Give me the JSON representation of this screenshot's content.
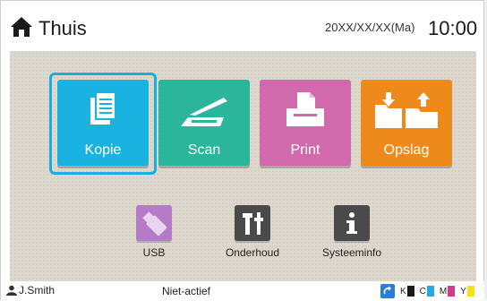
{
  "header": {
    "title": "Thuis",
    "date": "20XX/XX/XX(Ma)",
    "time": "10:00"
  },
  "tiles": [
    {
      "label": "Kopie",
      "color": "#1ab2e0",
      "icon": "copy-document-icon",
      "selected": true
    },
    {
      "label": "Scan",
      "color": "#2bb59a",
      "icon": "scanner-icon"
    },
    {
      "label": "Print",
      "color": "#d16aac",
      "icon": "printer-icon"
    },
    {
      "label": "Opslag",
      "color": "#ee8a1c",
      "icon": "folder-storage-icon"
    }
  ],
  "small_apps": [
    {
      "label": "USB",
      "icon": "usb-stick-icon",
      "color": "#b57bc7"
    },
    {
      "label": "Onderhoud",
      "icon": "tools-icon",
      "color": "#4a4a4a"
    },
    {
      "label": "Systeeminfo",
      "icon": "info-icon",
      "color": "#4a4a4a"
    }
  ],
  "footer": {
    "user": "J.Smith",
    "status": "Niet-actief",
    "ink": [
      {
        "letter": "K",
        "color": "#1a1a1a"
      },
      {
        "letter": "C",
        "color": "#2aa6e0"
      },
      {
        "letter": "M",
        "color": "#d13b8d"
      },
      {
        "letter": "Y",
        "color": "#f2e21b"
      }
    ]
  }
}
